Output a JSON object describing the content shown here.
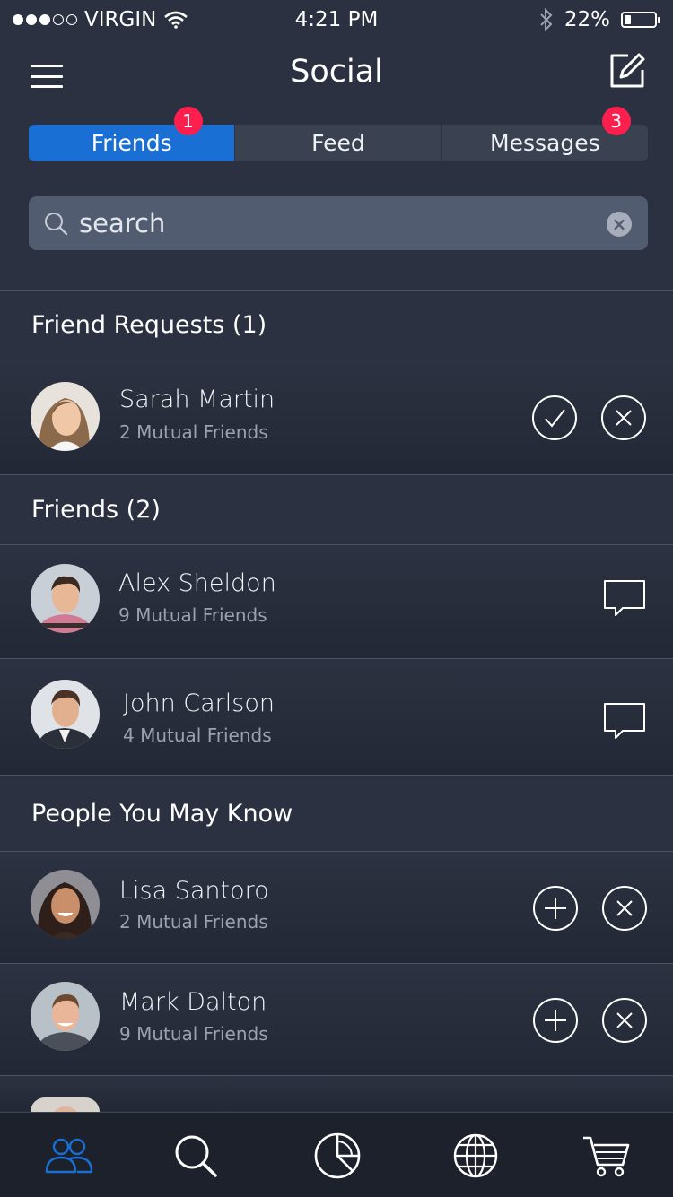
{
  "status_bar": {
    "carrier": "VIRGIN",
    "signal_bars_filled": 3,
    "signal_bars_total": 5,
    "time": "4:21 PM",
    "battery_percent": "22%",
    "battery_level": 0.22
  },
  "nav": {
    "title": "Social"
  },
  "tabs": [
    {
      "label": "Friends",
      "badge": "1",
      "active": true
    },
    {
      "label": "Feed",
      "badge": "",
      "active": false
    },
    {
      "label": "Messages",
      "badge": "3",
      "active": false
    }
  ],
  "search": {
    "placeholder": "search",
    "value": ""
  },
  "sections": {
    "requests": {
      "title": "Friend Requests (1)",
      "items": [
        {
          "name": "Sarah Martin",
          "mutual": "2 Mutual Friends",
          "avatar": "woman-light-hair"
        }
      ]
    },
    "friends": {
      "title": "Friends (2)",
      "items": [
        {
          "name": "Alex Sheldon",
          "mutual": "9 Mutual Friends",
          "avatar": "man-dark-hair"
        },
        {
          "name": "John Carlson",
          "mutual": "4 Mutual Friends",
          "avatar": "man-suit"
        }
      ]
    },
    "suggestions": {
      "title": "People You May Know",
      "items": [
        {
          "name": "Lisa Santoro",
          "mutual": "2 Mutual Friends",
          "avatar": "woman-dark-hair"
        },
        {
          "name": "Mark Dalton",
          "mutual": "9 Mutual Friends",
          "avatar": "man-brown-hair"
        }
      ]
    }
  },
  "tab_bar": {
    "items": [
      "people-icon",
      "search-icon",
      "pie-chart-icon",
      "globe-icon",
      "cart-icon"
    ],
    "active": "people-icon",
    "active_color": "#1a6fd4"
  },
  "colors": {
    "accent": "#1a6fd4",
    "badge": "#ff1f4f",
    "background": "#2b3140"
  }
}
